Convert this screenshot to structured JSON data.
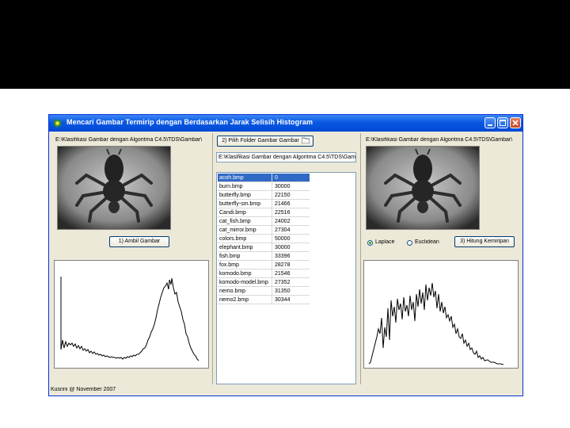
{
  "window": {
    "title": "Mencari Gambar Termirip dengan Berdasarkan Jarak Selisih Histogram"
  },
  "left_panel": {
    "path_label": "E:\\Klasifikasi Gambar dengan Algoritma C4.5\\TDS\\Gambar\\",
    "load_button": "1) Ambil Gambar"
  },
  "middle_panel": {
    "folder_button": "2) Pilih Folder Gambar Gambar",
    "folder_path": "E:\\Klasifikasi Gambar dengan Algoritma C4.5\\TDS\\Gambar\\",
    "files": [
      {
        "name": "acoh.bmp",
        "value": "0"
      },
      {
        "name": "burn.bmp",
        "value": "30000"
      },
      {
        "name": "butterfly.bmp",
        "value": "22150"
      },
      {
        "name": "butterfly-sm.bmp",
        "value": "21466"
      },
      {
        "name": "Candi.bmp",
        "value": "22516"
      },
      {
        "name": "cat_fish.bmp",
        "value": "24002"
      },
      {
        "name": "cat_mirror.bmp",
        "value": "27304"
      },
      {
        "name": "colors.bmp",
        "value": "50000"
      },
      {
        "name": "elephant.bmp",
        "value": "30000"
      },
      {
        "name": "fish.bmp",
        "value": "33396"
      },
      {
        "name": "fox.bmp",
        "value": "28278"
      },
      {
        "name": "komodo.bmp",
        "value": "21546"
      },
      {
        "name": "komodo-model.bmp",
        "value": "27352"
      },
      {
        "name": "nemo.bmp",
        "value": "31350"
      },
      {
        "name": "nemo2.bmp",
        "value": "30344"
      }
    ]
  },
  "right_panel": {
    "path_label": "E:\\Klasifikasi Gambar dengan Algoritma C4.5\\TDS\\Gambar\\",
    "radio_1": "Laplace",
    "radio_2": "Euclidean",
    "compute_button": "3) Hitung Kemiripan"
  },
  "status": "Kusrini @ November 2007"
}
